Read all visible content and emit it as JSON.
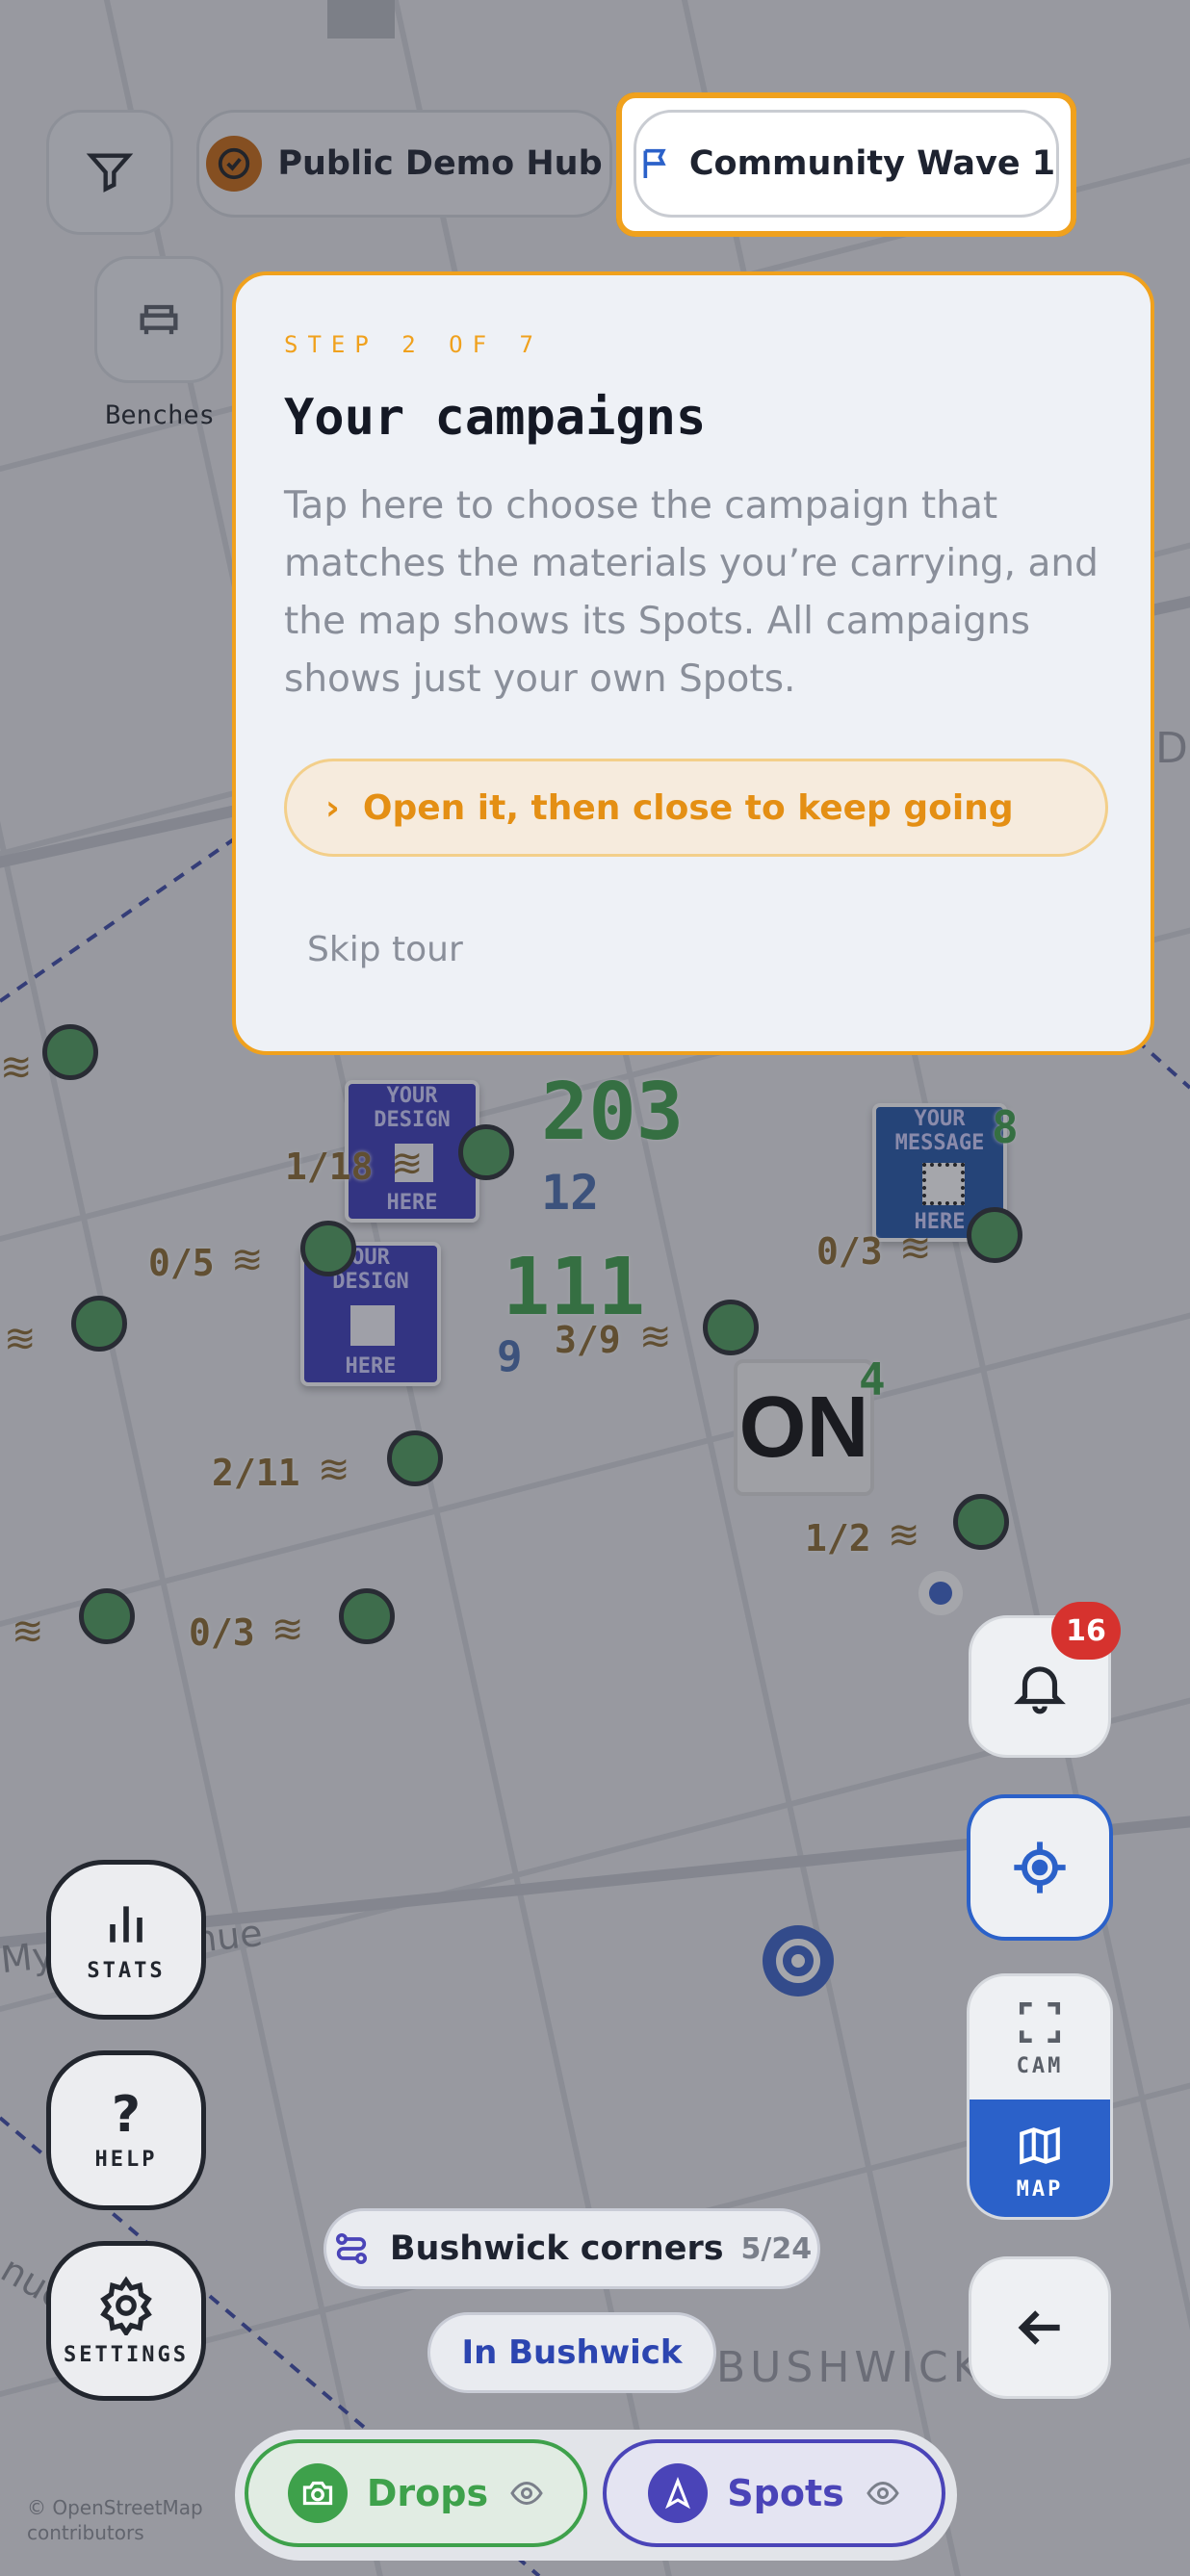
{
  "top_bar": {
    "hub_label": "Public Demo Hub",
    "campaign_label": "Community Wave 1"
  },
  "categories": [
    {
      "label": "Benches"
    }
  ],
  "tour": {
    "step": "STEP 2 OF 7",
    "title": "Your campaigns",
    "body": "Tap here to choose the campaign that matches the materials you’re carrying, and the map shows its Spots. All campaigns shows just your own Spots.",
    "cta": "Open it, then close to keep going",
    "skip": "Skip tour"
  },
  "map": {
    "clusters": [
      {
        "label": "1/18"
      },
      {
        "label": "0/5"
      },
      {
        "label": "3/9"
      },
      {
        "label": "2/11"
      },
      {
        "label": "0/3"
      },
      {
        "label": "1/2"
      },
      {
        "label": "0/3"
      }
    ],
    "big_numbers": [
      {
        "value": "203"
      },
      {
        "value": "111"
      },
      {
        "value": "12"
      },
      {
        "value": "9"
      },
      {
        "value": "8"
      },
      {
        "value": "4"
      }
    ],
    "posters": [
      {
        "lines": [
          "YOUR",
          "DESIGN",
          "HERE"
        ]
      },
      {
        "lines": [
          "OUR",
          "DESIGN",
          "HERE"
        ]
      },
      {
        "lines": [
          "YOUR",
          "MESSAGE",
          "HERE"
        ]
      }
    ],
    "sign_text": "ON",
    "street_label": "Myrtle Avenue",
    "street_label_2": "nue",
    "district_label": "BUSHWICK",
    "edge_letter": "D",
    "attribution_line1": "© OpenStreetMap",
    "attribution_line2": "contributors"
  },
  "left_controls": {
    "stats": "STATS",
    "help": "HELP",
    "settings": "SETTINGS"
  },
  "right_controls": {
    "notification_count": "16",
    "cam": "CAM",
    "map": "MAP"
  },
  "bottom": {
    "route_name": "Bushwick corners",
    "route_progress": "5/24",
    "area_label": "In Bushwick",
    "drops_label": "Drops",
    "spots_label": "Spots"
  },
  "colors": {
    "accent": "#f0a11d",
    "blue": "#2b61c9",
    "green": "#3ea14b",
    "purple": "#4a44b8"
  }
}
